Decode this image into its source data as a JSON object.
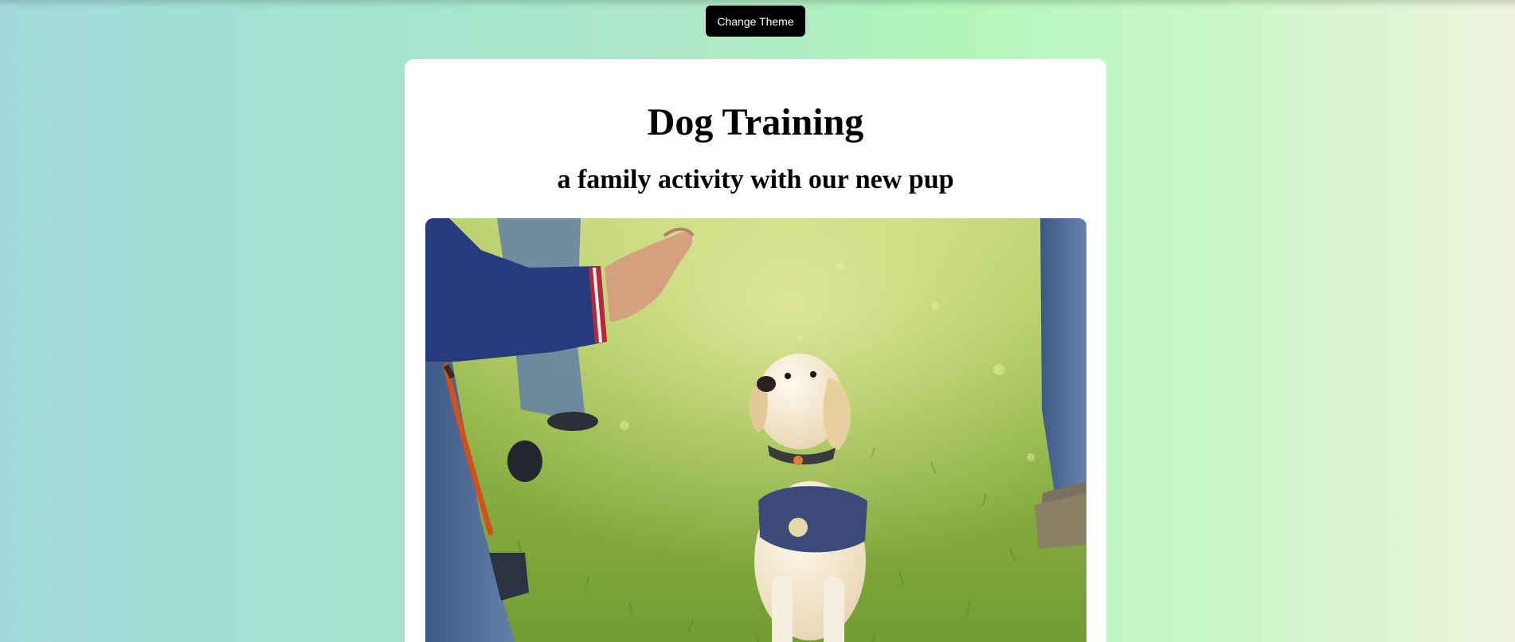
{
  "toolbar": {
    "theme_button_label": "Change Theme"
  },
  "card": {
    "title": "Dog Training",
    "subtitle": "a family activity with our new pup"
  },
  "photo": {
    "description_icon": "dog-photo",
    "accent_colors": {
      "grass": "#7fa63a",
      "sleeve": "#283a7e",
      "jeans": "#4a6a98",
      "leash": "#d2501e",
      "puppy": "#f2e7cf",
      "vest": "#3b4a78"
    }
  },
  "colors": {
    "button_bg": "#000000",
    "button_text": "#ffffff",
    "card_bg": "#ffffff"
  }
}
